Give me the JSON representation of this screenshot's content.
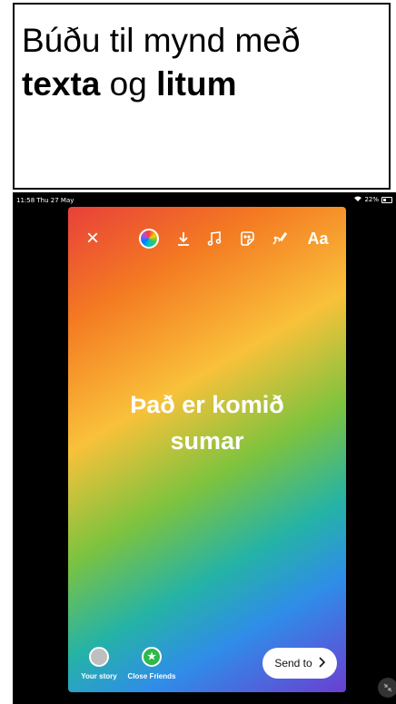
{
  "caption": {
    "line1": "Búðu til mynd með",
    "bold1": "texta",
    "mid": " og ",
    "bold2": "litum"
  },
  "statusbar": {
    "time": "11:58 Thu 27 May",
    "battery": "22%"
  },
  "toolbar": {
    "close_icon": "×",
    "text_label": "Aa"
  },
  "story": {
    "line1": "Það er komið",
    "line2": "sumar"
  },
  "bottom": {
    "your_story": "Your story",
    "close_friends": "Close Friends",
    "send_to": "Send to"
  }
}
